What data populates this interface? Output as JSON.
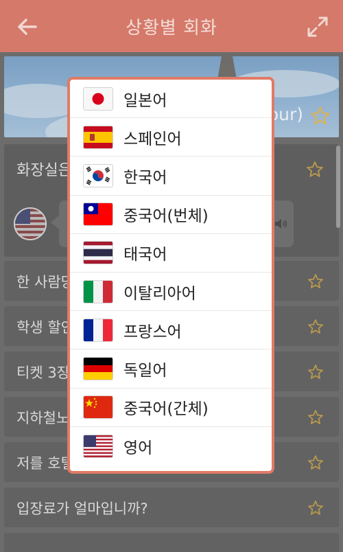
{
  "topbar": {
    "title": "상황별 회화"
  },
  "banner": {
    "caption": "our)"
  },
  "expanded": {
    "question": "화장실은"
  },
  "rows": [
    {
      "text": "한 사람당"
    },
    {
      "text": "학생 할인"
    },
    {
      "text": "티켓 3장"
    },
    {
      "text": "지하철노"
    },
    {
      "text": "저를 호텔"
    },
    {
      "text": "입장료가 얼마입니까?"
    }
  ],
  "language_dialog": {
    "options": [
      {
        "label": "일본어",
        "flag": "japan-flag-icon"
      },
      {
        "label": "스페인어",
        "flag": "spain-flag-icon"
      },
      {
        "label": "한국어",
        "flag": "korea-flag-icon"
      },
      {
        "label": "중국어(번체)",
        "flag": "taiwan-flag-icon"
      },
      {
        "label": "태국어",
        "flag": "thailand-flag-icon"
      },
      {
        "label": "이탈리아어",
        "flag": "italy-flag-icon"
      },
      {
        "label": "프랑스어",
        "flag": "france-flag-icon"
      },
      {
        "label": "독일어",
        "flag": "germany-flag-icon"
      },
      {
        "label": "중국어(간체)",
        "flag": "china-flag-icon"
      },
      {
        "label": "영어",
        "flag": "usa-flag-icon"
      }
    ]
  },
  "colors": {
    "accent": "#d5796a",
    "dialog_border": "#e07a66",
    "star": "#d8b25a"
  }
}
